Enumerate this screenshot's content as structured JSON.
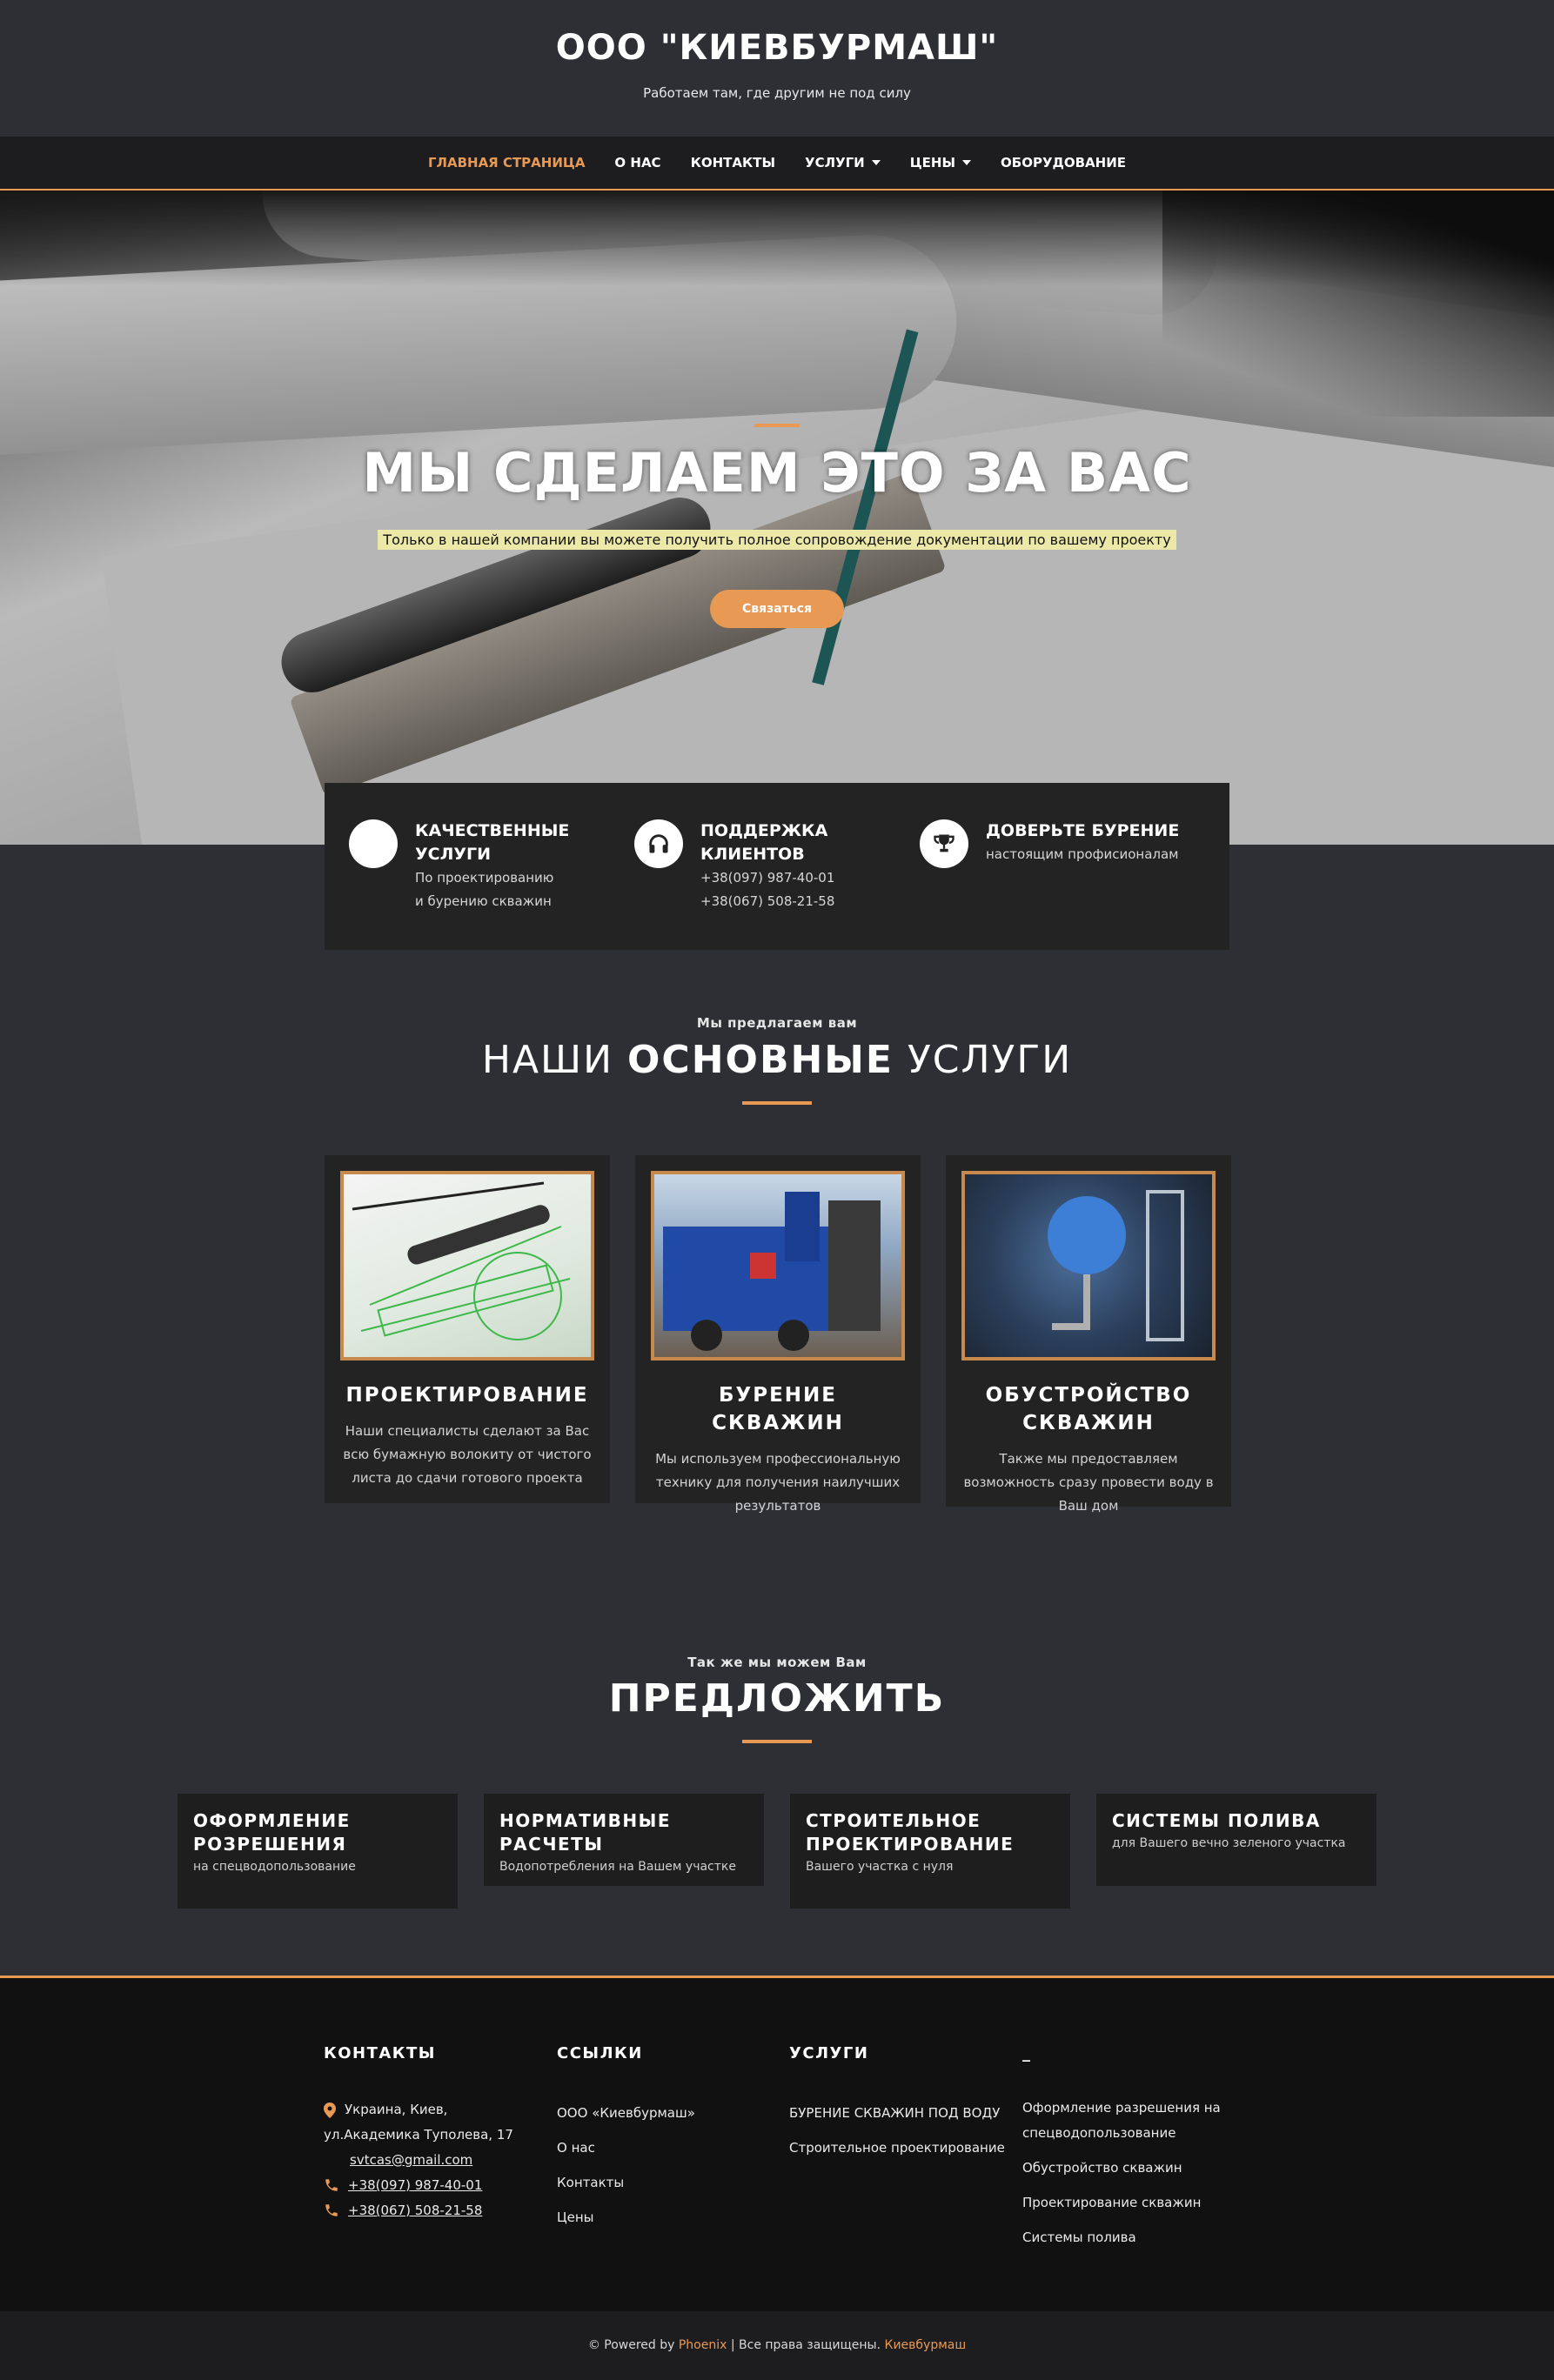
{
  "header": {
    "title": "ООО \"КИЕВБУРМАШ\"",
    "tagline": "Работаем там, где другим не под силу"
  },
  "nav": {
    "items": [
      {
        "label": "ГЛАВНАЯ СТРАНИЦА",
        "active": true
      },
      {
        "label": "О НАС"
      },
      {
        "label": "КОНТАКТЫ"
      },
      {
        "label": "УСЛУГИ",
        "dropdown": true
      },
      {
        "label": "ЦЕНЫ",
        "dropdown": true
      },
      {
        "label": "ОБОРУДОВАНИЕ"
      }
    ]
  },
  "hero": {
    "title": "МЫ СДЕЛАЕМ ЭТО ЗА ВАС",
    "subtitle": "Только в нашей компании вы можете получить полное сопровождение документации по вашему проекту",
    "button": "Связаться"
  },
  "features": [
    {
      "icon": "circle-icon",
      "title": "КАЧЕСТВЕННЫЕ УСЛУГИ",
      "text": "По проектированию и бурению скважин"
    },
    {
      "icon": "headphones-icon",
      "title": "ПОДДЕРЖКА КЛИЕНТОВ",
      "text": "+38(097) 987-40-01",
      "text2": "+38(067) 508-21-58"
    },
    {
      "icon": "trophy-icon",
      "title": "ДОВЕРЬТЕ БУРЕНИЕ",
      "text": "настоящим профисионалам"
    }
  ],
  "services": {
    "kicker": "Мы предлагаем вам",
    "title_pre": "НАШИ ",
    "title_bold": "ОСНОВНЫЕ",
    "title_post": " УСЛУГИ",
    "cards": [
      {
        "title": "ПРОЕКТИРОВАНИЕ",
        "text": "Наши специалисты сделают за Вас всю бумажную волокиту от чистого листа до сдачи готового проекта"
      },
      {
        "title": "БУРЕНИЕ СКВАЖИН",
        "text": "Мы используем профессиональную технику для получения наилучших результатов"
      },
      {
        "title": "ОБУСТРОЙСТВО СКВАЖИН",
        "text": "Также мы предоставляем возможность сразу провести воду в Ваш дом"
      }
    ]
  },
  "offer": {
    "kicker": "Так же мы можем Вам",
    "title": "ПРЕДЛОЖИТЬ",
    "cards": [
      {
        "title": "ОФОРМЛЕНИЕ РОЗРЕШЕНИЯ",
        "text": "на спецводопользование"
      },
      {
        "title": "НОРМАТИВНЫЕ РАСЧЕТЫ",
        "text": "Водопотребления на Вашем участке"
      },
      {
        "title": "СТРОИТЕЛЬНОЕ ПРОЕКТИРОВАНИЕ",
        "text": "Вашего участка с нуля"
      },
      {
        "title": "СИСТЕМЫ ПОЛИВА",
        "text": "для Вашего вечно зеленого участка"
      }
    ]
  },
  "footer": {
    "contacts": {
      "head": "КОНТАКТЫ",
      "address1": "Украина, Киев,",
      "address2": "ул.Академика Туполева, 17",
      "email": "svtcas@gmail.com",
      "phone1": "+38(097) 987-40-01",
      "phone2": "+38(067) 508-21-58"
    },
    "links": {
      "head": "ССЫЛКИ",
      "items": [
        "ООО «Киевбурмаш»",
        "О нас",
        "Контакты",
        "Цены"
      ]
    },
    "services": {
      "head": "УСЛУГИ",
      "items": [
        "БУРЕНИЕ СКВАЖИН ПОД ВОДУ",
        "Строительное проектирование"
      ]
    },
    "extra": {
      "head": "_",
      "items": [
        "Оформление разрешения на спецводопользование",
        "Обустройство скважин",
        "Проектирование скважин",
        "Системы полива"
      ]
    },
    "copyright": {
      "prefix": "© Powered by ",
      "brand": "Phoenix",
      "middle": " | Все права защищены. ",
      "company": "Киевбурмаш"
    }
  },
  "colors": {
    "accent": "#e89a55",
    "background": "#2e2f35",
    "card": "#232324",
    "footer": "#111112"
  }
}
